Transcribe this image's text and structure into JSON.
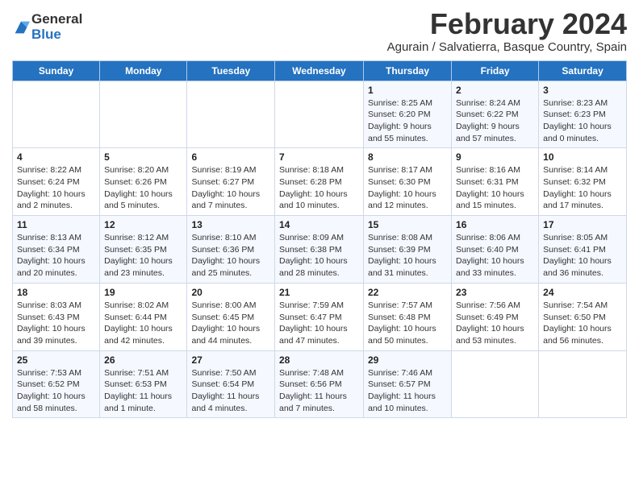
{
  "logo": {
    "general": "General",
    "blue": "Blue"
  },
  "title": "February 2024",
  "subtitle": "Agurain / Salvatierra, Basque Country, Spain",
  "weekdays": [
    "Sunday",
    "Monday",
    "Tuesday",
    "Wednesday",
    "Thursday",
    "Friday",
    "Saturday"
  ],
  "weeks": [
    [
      {
        "day": "",
        "info": ""
      },
      {
        "day": "",
        "info": ""
      },
      {
        "day": "",
        "info": ""
      },
      {
        "day": "",
        "info": ""
      },
      {
        "day": "1",
        "info": "Sunrise: 8:25 AM\nSunset: 6:20 PM\nDaylight: 9 hours and 55 minutes."
      },
      {
        "day": "2",
        "info": "Sunrise: 8:24 AM\nSunset: 6:22 PM\nDaylight: 9 hours and 57 minutes."
      },
      {
        "day": "3",
        "info": "Sunrise: 8:23 AM\nSunset: 6:23 PM\nDaylight: 10 hours and 0 minutes."
      }
    ],
    [
      {
        "day": "4",
        "info": "Sunrise: 8:22 AM\nSunset: 6:24 PM\nDaylight: 10 hours and 2 minutes."
      },
      {
        "day": "5",
        "info": "Sunrise: 8:20 AM\nSunset: 6:26 PM\nDaylight: 10 hours and 5 minutes."
      },
      {
        "day": "6",
        "info": "Sunrise: 8:19 AM\nSunset: 6:27 PM\nDaylight: 10 hours and 7 minutes."
      },
      {
        "day": "7",
        "info": "Sunrise: 8:18 AM\nSunset: 6:28 PM\nDaylight: 10 hours and 10 minutes."
      },
      {
        "day": "8",
        "info": "Sunrise: 8:17 AM\nSunset: 6:30 PM\nDaylight: 10 hours and 12 minutes."
      },
      {
        "day": "9",
        "info": "Sunrise: 8:16 AM\nSunset: 6:31 PM\nDaylight: 10 hours and 15 minutes."
      },
      {
        "day": "10",
        "info": "Sunrise: 8:14 AM\nSunset: 6:32 PM\nDaylight: 10 hours and 17 minutes."
      }
    ],
    [
      {
        "day": "11",
        "info": "Sunrise: 8:13 AM\nSunset: 6:34 PM\nDaylight: 10 hours and 20 minutes."
      },
      {
        "day": "12",
        "info": "Sunrise: 8:12 AM\nSunset: 6:35 PM\nDaylight: 10 hours and 23 minutes."
      },
      {
        "day": "13",
        "info": "Sunrise: 8:10 AM\nSunset: 6:36 PM\nDaylight: 10 hours and 25 minutes."
      },
      {
        "day": "14",
        "info": "Sunrise: 8:09 AM\nSunset: 6:38 PM\nDaylight: 10 hours and 28 minutes."
      },
      {
        "day": "15",
        "info": "Sunrise: 8:08 AM\nSunset: 6:39 PM\nDaylight: 10 hours and 31 minutes."
      },
      {
        "day": "16",
        "info": "Sunrise: 8:06 AM\nSunset: 6:40 PM\nDaylight: 10 hours and 33 minutes."
      },
      {
        "day": "17",
        "info": "Sunrise: 8:05 AM\nSunset: 6:41 PM\nDaylight: 10 hours and 36 minutes."
      }
    ],
    [
      {
        "day": "18",
        "info": "Sunrise: 8:03 AM\nSunset: 6:43 PM\nDaylight: 10 hours and 39 minutes."
      },
      {
        "day": "19",
        "info": "Sunrise: 8:02 AM\nSunset: 6:44 PM\nDaylight: 10 hours and 42 minutes."
      },
      {
        "day": "20",
        "info": "Sunrise: 8:00 AM\nSunset: 6:45 PM\nDaylight: 10 hours and 44 minutes."
      },
      {
        "day": "21",
        "info": "Sunrise: 7:59 AM\nSunset: 6:47 PM\nDaylight: 10 hours and 47 minutes."
      },
      {
        "day": "22",
        "info": "Sunrise: 7:57 AM\nSunset: 6:48 PM\nDaylight: 10 hours and 50 minutes."
      },
      {
        "day": "23",
        "info": "Sunrise: 7:56 AM\nSunset: 6:49 PM\nDaylight: 10 hours and 53 minutes."
      },
      {
        "day": "24",
        "info": "Sunrise: 7:54 AM\nSunset: 6:50 PM\nDaylight: 10 hours and 56 minutes."
      }
    ],
    [
      {
        "day": "25",
        "info": "Sunrise: 7:53 AM\nSunset: 6:52 PM\nDaylight: 10 hours and 58 minutes."
      },
      {
        "day": "26",
        "info": "Sunrise: 7:51 AM\nSunset: 6:53 PM\nDaylight: 11 hours and 1 minute."
      },
      {
        "day": "27",
        "info": "Sunrise: 7:50 AM\nSunset: 6:54 PM\nDaylight: 11 hours and 4 minutes."
      },
      {
        "day": "28",
        "info": "Sunrise: 7:48 AM\nSunset: 6:56 PM\nDaylight: 11 hours and 7 minutes."
      },
      {
        "day": "29",
        "info": "Sunrise: 7:46 AM\nSunset: 6:57 PM\nDaylight: 11 hours and 10 minutes."
      },
      {
        "day": "",
        "info": ""
      },
      {
        "day": "",
        "info": ""
      }
    ]
  ]
}
